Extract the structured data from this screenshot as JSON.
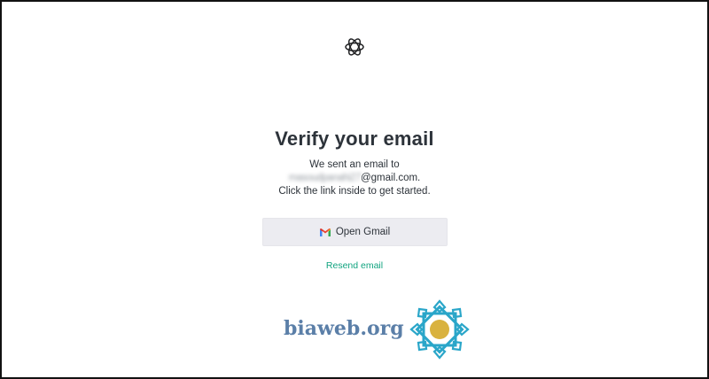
{
  "page": {
    "title": "Verify your email",
    "message_line1": "We sent an email to",
    "email_local_blurred": "masoudpanahi27",
    "email_domain": "@gmail.com.",
    "message_line3": "Click the link inside to get started."
  },
  "actions": {
    "open_gmail_label": "Open Gmail",
    "resend_label": "Resend email"
  },
  "watermark": {
    "text": "biaweb.org"
  },
  "icons": {
    "brand_logo": "openai-logo-icon",
    "gmail": "gmail-icon",
    "watermark_emblem": "biaweb-emblem-icon"
  },
  "colors": {
    "link": "#10a37f",
    "button_bg": "#ececf1",
    "text": "#2d333a",
    "watermark_text": "#5b7fa8",
    "emblem_teal": "#2aa6c9",
    "emblem_gold": "#d9b23f"
  }
}
